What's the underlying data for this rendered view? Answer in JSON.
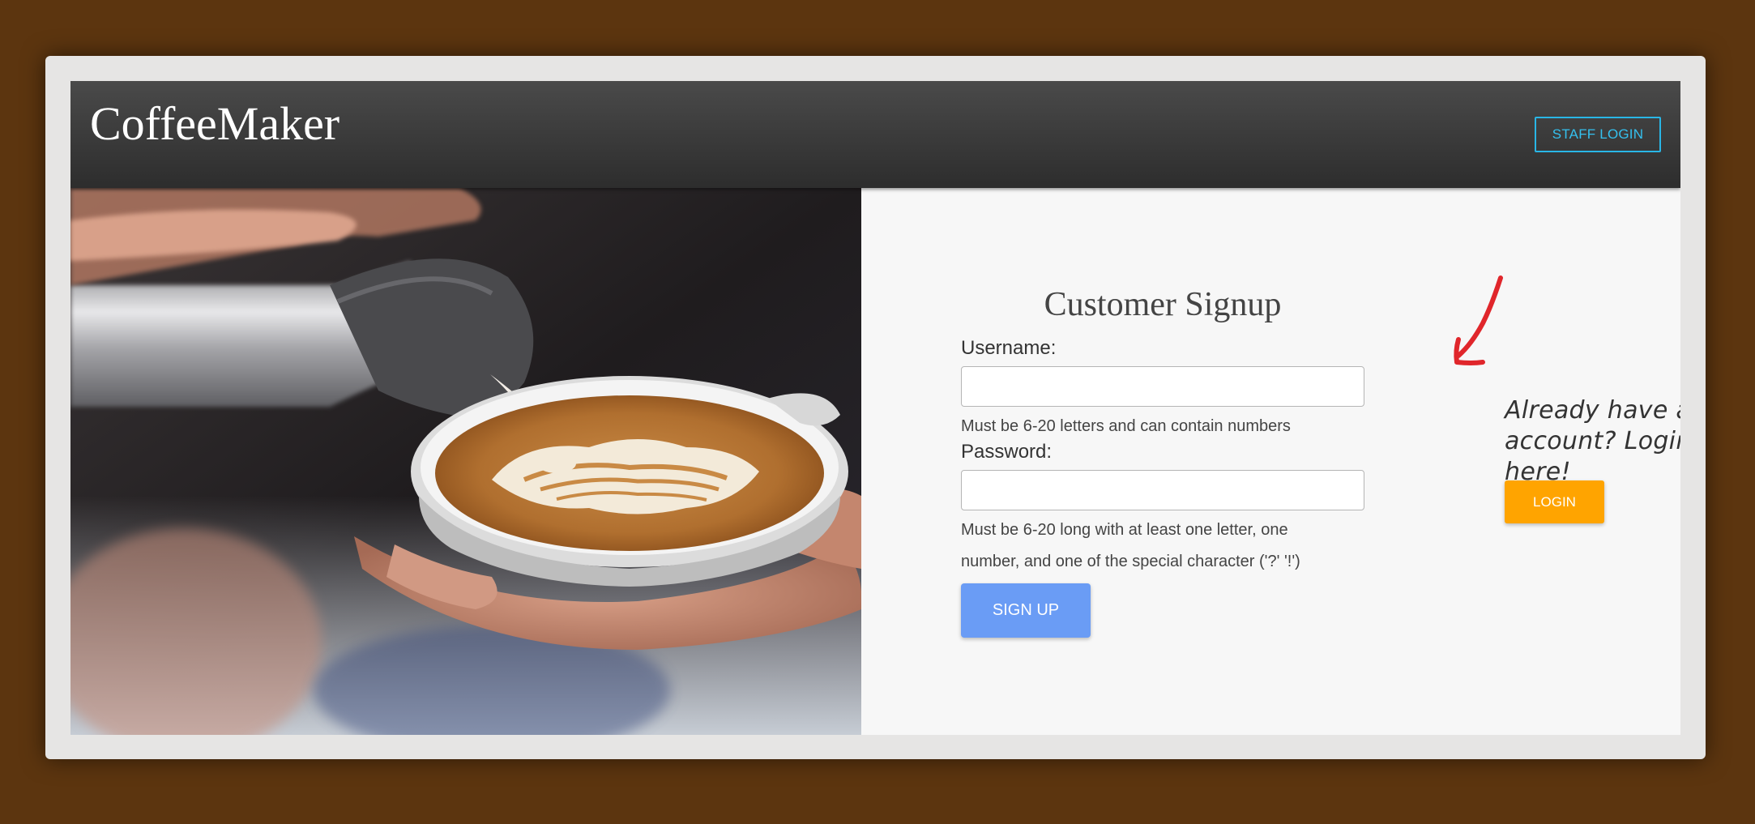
{
  "header": {
    "brand": "CoffeeMaker",
    "staff_login_label": "STAFF LOGIN"
  },
  "signup": {
    "title": "Customer Signup",
    "username_label": "Username:",
    "username_value": "",
    "username_hint": "Must be 6-20 letters and can contain numbers",
    "password_label": "Password:",
    "password_value": "",
    "password_hint": "Must be 6-20 long with at least one letter, one number, and one of the special character ('?' '!')",
    "signup_label": "SIGN UP"
  },
  "login_prompt": {
    "text": "Already have an account? Login here!",
    "login_label": "LOGIN"
  },
  "colors": {
    "page_background": "#5c350f",
    "header_background": "#333333",
    "staff_login_accent": "#29b6e6",
    "signup_button": "#6a9cf5",
    "login_button": "#ffa400",
    "arrow": "#e0262b"
  },
  "icons": {
    "arrow": "hand-drawn-arrow-icon"
  }
}
